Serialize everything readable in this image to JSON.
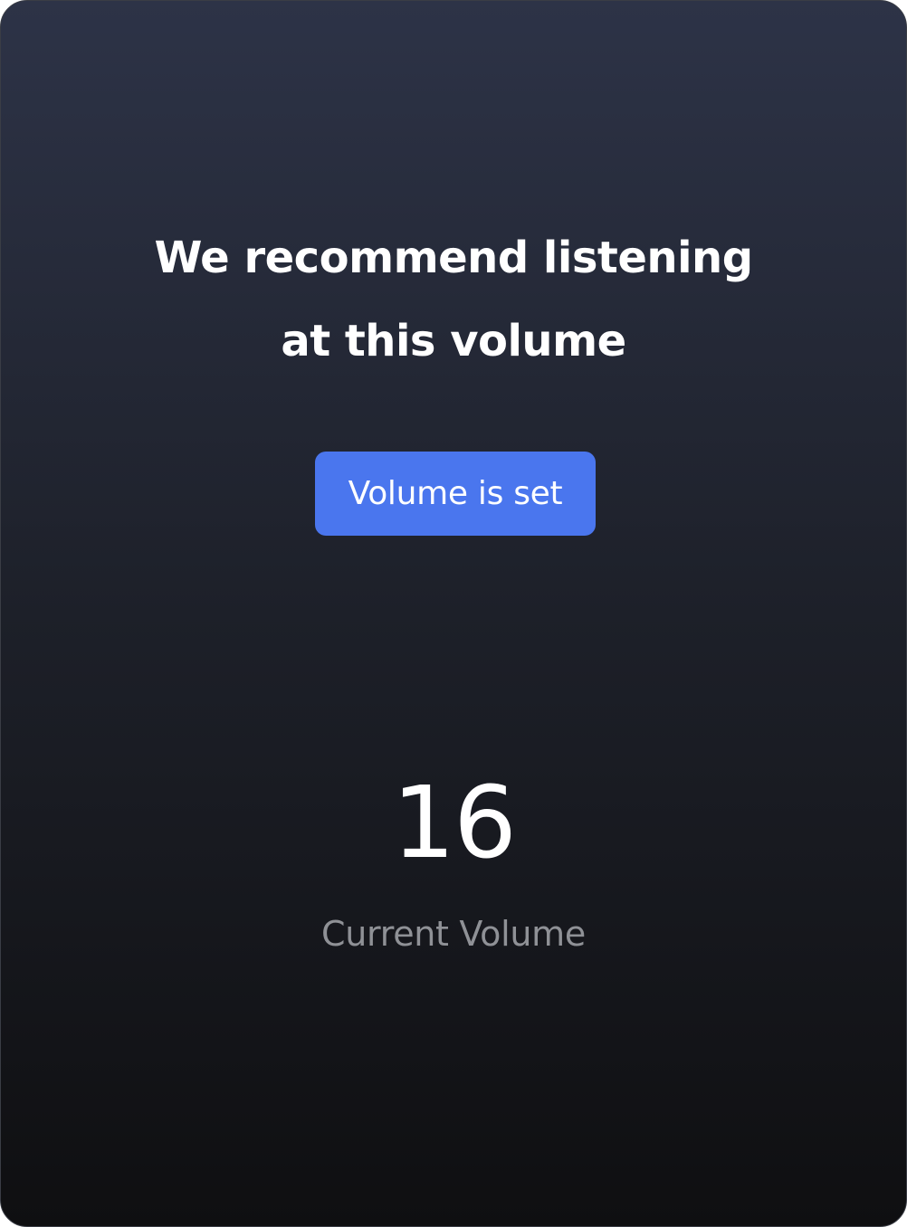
{
  "headline": {
    "line1": "We recommend listening",
    "line2": "at this volume"
  },
  "confirm_button": {
    "label": "Volume is set"
  },
  "volume": {
    "value": "16",
    "label": "Current Volume"
  },
  "colors": {
    "accent": "#4a76ee",
    "background_top": "#2d3347",
    "background_bottom": "#0f0f11",
    "text_primary": "#ffffff",
    "text_secondary": "#8f9196"
  }
}
